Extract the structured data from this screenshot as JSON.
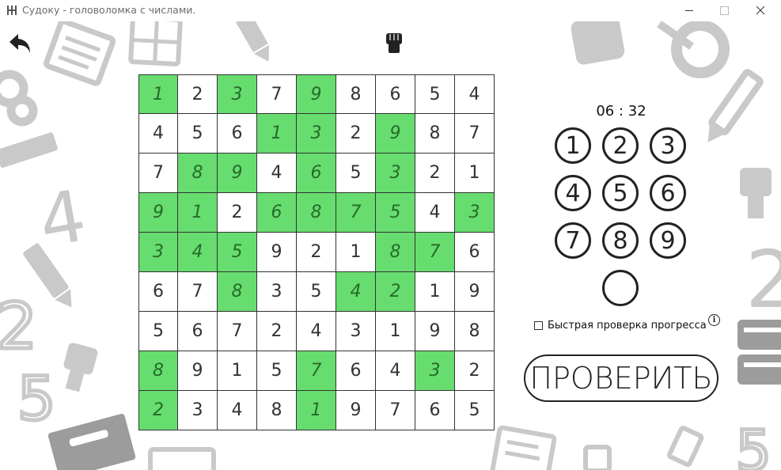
{
  "window": {
    "title": "Судоку - головоломка с числами.",
    "minimize_glyph": "—",
    "maximize_glyph": "☐",
    "close_glyph": "✕"
  },
  "toolbar": {
    "back_icon": "back-arrow-icon",
    "hint_icon": "fist-icon"
  },
  "timer": "06 : 32",
  "grid": [
    [
      {
        "v": "1",
        "u": true
      },
      {
        "v": "2",
        "u": false
      },
      {
        "v": "3",
        "u": true
      },
      {
        "v": "7",
        "u": false
      },
      {
        "v": "9",
        "u": true
      },
      {
        "v": "8",
        "u": false
      },
      {
        "v": "6",
        "u": false
      },
      {
        "v": "5",
        "u": false
      },
      {
        "v": "4",
        "u": false
      }
    ],
    [
      {
        "v": "4",
        "u": false
      },
      {
        "v": "5",
        "u": false
      },
      {
        "v": "6",
        "u": false
      },
      {
        "v": "1",
        "u": true
      },
      {
        "v": "3",
        "u": true
      },
      {
        "v": "2",
        "u": false
      },
      {
        "v": "9",
        "u": true
      },
      {
        "v": "8",
        "u": false
      },
      {
        "v": "7",
        "u": false
      }
    ],
    [
      {
        "v": "7",
        "u": false
      },
      {
        "v": "8",
        "u": true
      },
      {
        "v": "9",
        "u": true
      },
      {
        "v": "4",
        "u": false
      },
      {
        "v": "6",
        "u": true
      },
      {
        "v": "5",
        "u": false
      },
      {
        "v": "3",
        "u": true
      },
      {
        "v": "2",
        "u": false
      },
      {
        "v": "1",
        "u": false
      }
    ],
    [
      {
        "v": "9",
        "u": true
      },
      {
        "v": "1",
        "u": true
      },
      {
        "v": "2",
        "u": false
      },
      {
        "v": "6",
        "u": true
      },
      {
        "v": "8",
        "u": true
      },
      {
        "v": "7",
        "u": true
      },
      {
        "v": "5",
        "u": true
      },
      {
        "v": "4",
        "u": false
      },
      {
        "v": "3",
        "u": true
      }
    ],
    [
      {
        "v": "3",
        "u": true
      },
      {
        "v": "4",
        "u": true
      },
      {
        "v": "5",
        "u": true
      },
      {
        "v": "9",
        "u": false
      },
      {
        "v": "2",
        "u": false
      },
      {
        "v": "1",
        "u": false
      },
      {
        "v": "8",
        "u": true
      },
      {
        "v": "7",
        "u": true
      },
      {
        "v": "6",
        "u": false
      }
    ],
    [
      {
        "v": "6",
        "u": false
      },
      {
        "v": "7",
        "u": false
      },
      {
        "v": "8",
        "u": true
      },
      {
        "v": "3",
        "u": false
      },
      {
        "v": "5",
        "u": false
      },
      {
        "v": "4",
        "u": true
      },
      {
        "v": "2",
        "u": true
      },
      {
        "v": "1",
        "u": false
      },
      {
        "v": "9",
        "u": false
      }
    ],
    [
      {
        "v": "5",
        "u": false
      },
      {
        "v": "6",
        "u": false
      },
      {
        "v": "7",
        "u": false
      },
      {
        "v": "2",
        "u": false
      },
      {
        "v": "4",
        "u": false
      },
      {
        "v": "3",
        "u": false
      },
      {
        "v": "1",
        "u": false
      },
      {
        "v": "9",
        "u": false
      },
      {
        "v": "8",
        "u": false
      }
    ],
    [
      {
        "v": "8",
        "u": true
      },
      {
        "v": "9",
        "u": false
      },
      {
        "v": "1",
        "u": false
      },
      {
        "v": "5",
        "u": false
      },
      {
        "v": "7",
        "u": true
      },
      {
        "v": "6",
        "u": false
      },
      {
        "v": "4",
        "u": false
      },
      {
        "v": "3",
        "u": true
      },
      {
        "v": "2",
        "u": false
      }
    ],
    [
      {
        "v": "2",
        "u": true
      },
      {
        "v": "3",
        "u": false
      },
      {
        "v": "4",
        "u": false
      },
      {
        "v": "8",
        "u": false
      },
      {
        "v": "1",
        "u": true
      },
      {
        "v": "9",
        "u": false
      },
      {
        "v": "7",
        "u": false
      },
      {
        "v": "6",
        "u": false
      },
      {
        "v": "5",
        "u": false
      }
    ]
  ],
  "number_buttons": [
    "1",
    "2",
    "3",
    "4",
    "5",
    "6",
    "7",
    "8",
    "9",
    ""
  ],
  "fast_check_label": "Быстрая проверка прогресса",
  "fast_check_checked": false,
  "info_glyph": "i",
  "check_button_label": "ПРОВЕРИТЬ",
  "colors": {
    "user_cell_bg": "#66dd6e",
    "user_digit": "#266b2a",
    "background_decor": "#cccccc"
  }
}
